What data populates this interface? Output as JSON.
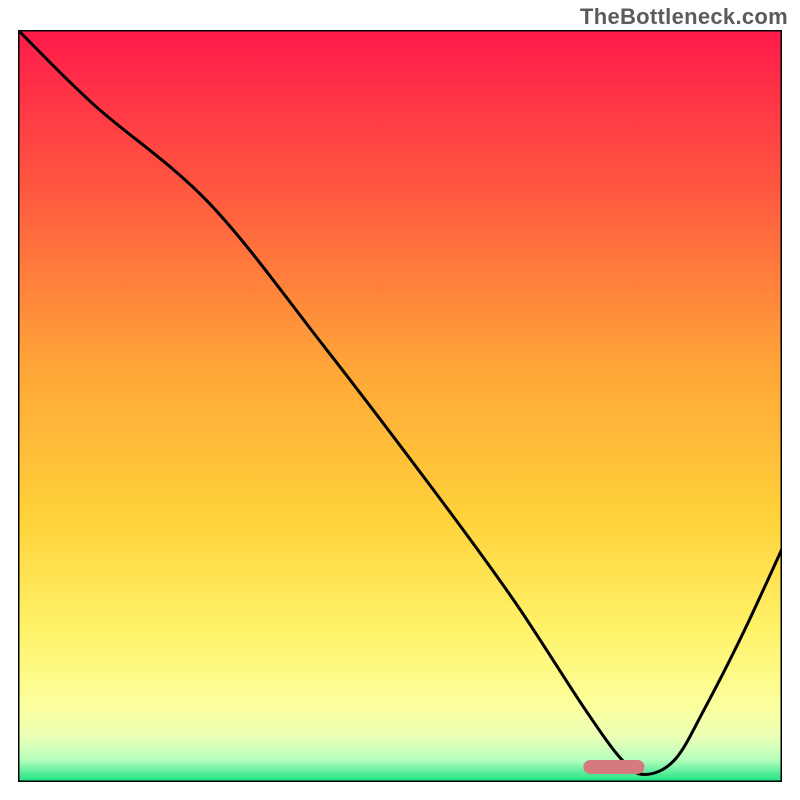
{
  "watermark": "TheBottleneck.com",
  "chart_data": {
    "type": "line",
    "title": "",
    "xlabel": "",
    "ylabel": "",
    "xlim": [
      0,
      100
    ],
    "ylim": [
      0,
      100
    ],
    "series": [
      {
        "name": "curve",
        "x": [
          0,
          10,
          25,
          40,
          55,
          65,
          74,
          79,
          82,
          86,
          90,
          95,
          100
        ],
        "y": [
          100,
          90,
          77,
          58,
          38,
          24,
          10,
          3,
          1,
          3,
          10,
          20,
          31
        ]
      }
    ],
    "marker": {
      "x_start": 74,
      "x_end": 82,
      "y": 2
    },
    "background": {
      "kind": "vertical_gradient",
      "stops": [
        {
          "offset": 0.0,
          "color": "#ff1a4b"
        },
        {
          "offset": 0.2,
          "color": "#ff5440"
        },
        {
          "offset": 0.45,
          "color": "#ffa638"
        },
        {
          "offset": 0.65,
          "color": "#ffd23a"
        },
        {
          "offset": 0.8,
          "color": "#fff36a"
        },
        {
          "offset": 0.9,
          "color": "#fcff9e"
        },
        {
          "offset": 0.94,
          "color": "#eaffb5"
        },
        {
          "offset": 0.97,
          "color": "#b8ffbe"
        },
        {
          "offset": 1.0,
          "color": "#18e082"
        }
      ]
    }
  }
}
